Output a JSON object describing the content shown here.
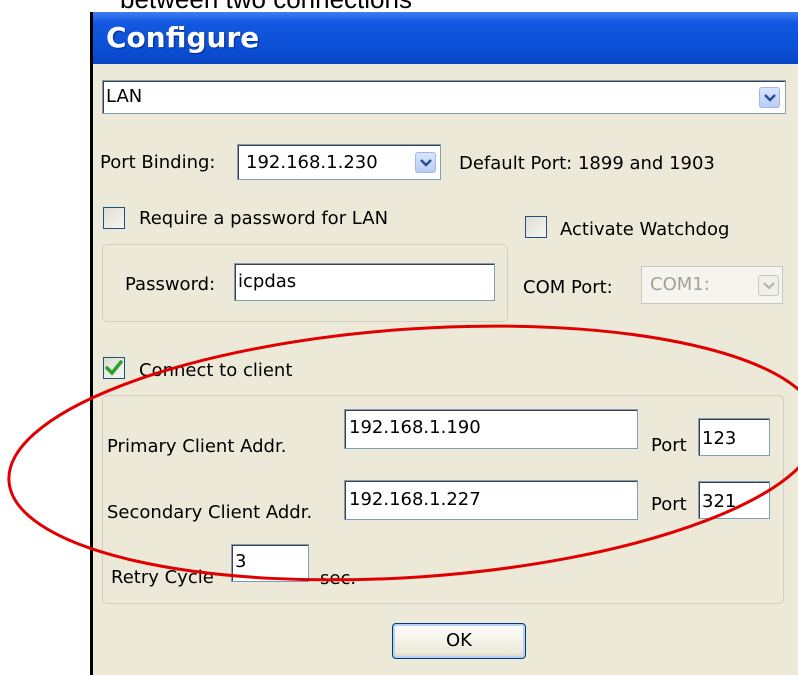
{
  "caption": "between two connections",
  "window": {
    "title": "Configure"
  },
  "connection_type": {
    "value": "LAN"
  },
  "port_binding": {
    "label": "Port Binding:",
    "value": "192.168.1.230",
    "default_port": "Default Port: 1899 and 1903"
  },
  "require_password": {
    "label": "Require a password for LAN",
    "checked": false
  },
  "password": {
    "label": "Password:",
    "value": "icpdas"
  },
  "watchdog": {
    "label": "Activate Watchdog",
    "checked": false
  },
  "com_port": {
    "label": "COM Port:",
    "value": "COM1:",
    "enabled": false
  },
  "connect_client": {
    "label": "Connect to client",
    "checked": true
  },
  "primary_client": {
    "label": "Primary Client Addr.",
    "address": "192.168.1.190",
    "port_label": "Port",
    "port": "123"
  },
  "secondary_client": {
    "label": "Secondary Client Addr.",
    "address": "192.168.1.227",
    "port_label": "Port",
    "port": "321"
  },
  "retry": {
    "label": "Retry Cycle",
    "value": "3",
    "unit": "sec."
  },
  "ok_button": {
    "label": "OK"
  },
  "colors": {
    "titlebar": "#0a4fd6",
    "annotation": "#e00000",
    "checkmark": "#2aa52a"
  }
}
